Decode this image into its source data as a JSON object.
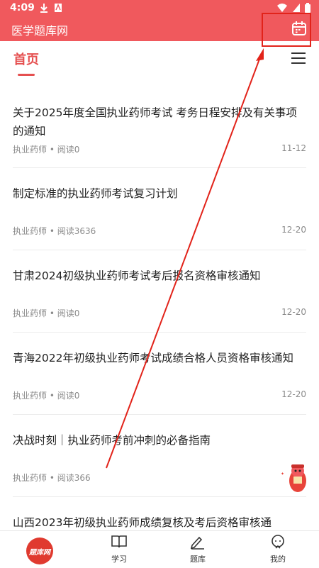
{
  "status_bar": {
    "time": "4:09"
  },
  "app_bar": {
    "title": "医学题库网"
  },
  "tabs": {
    "home_label": "首页"
  },
  "articles": [
    {
      "title": "关于2025年度全国执业药师考试 考务日程安排及有关事项的通知",
      "category": "执业药师",
      "reads": "阅读0",
      "date": "11-12"
    },
    {
      "title": "制定标准的执业药师考试复习计划",
      "category": "执业药师",
      "reads": "阅读3636",
      "date": "12-20"
    },
    {
      "title": "甘肃2024初级执业药师考试考后报名资格审核通知",
      "category": "执业药师",
      "reads": "阅读0",
      "date": "12-20"
    },
    {
      "title": "青海2022年初级执业药师考试成绩合格人员资格审核通知",
      "category": "执业药师",
      "reads": "阅读0",
      "date": "12-20"
    },
    {
      "title": "决战时刻｜执业药师考前冲刺的必备指南",
      "category": "执业药师",
      "reads": "阅读366",
      "date": ""
    },
    {
      "title": "山西2023年初级执业药师成绩复核及考后资格审核通",
      "category": "",
      "reads": "",
      "date": ""
    }
  ],
  "meta_separator": "•",
  "bottom_nav": {
    "logo_text": "题库网",
    "items": [
      {
        "label": "学习",
        "icon": "book-icon"
      },
      {
        "label": "题库",
        "icon": "pencil-icon"
      },
      {
        "label": "我的",
        "icon": "chat-icon"
      }
    ]
  },
  "colors": {
    "accent": "#f0595d",
    "annotation": "#e2231a"
  }
}
